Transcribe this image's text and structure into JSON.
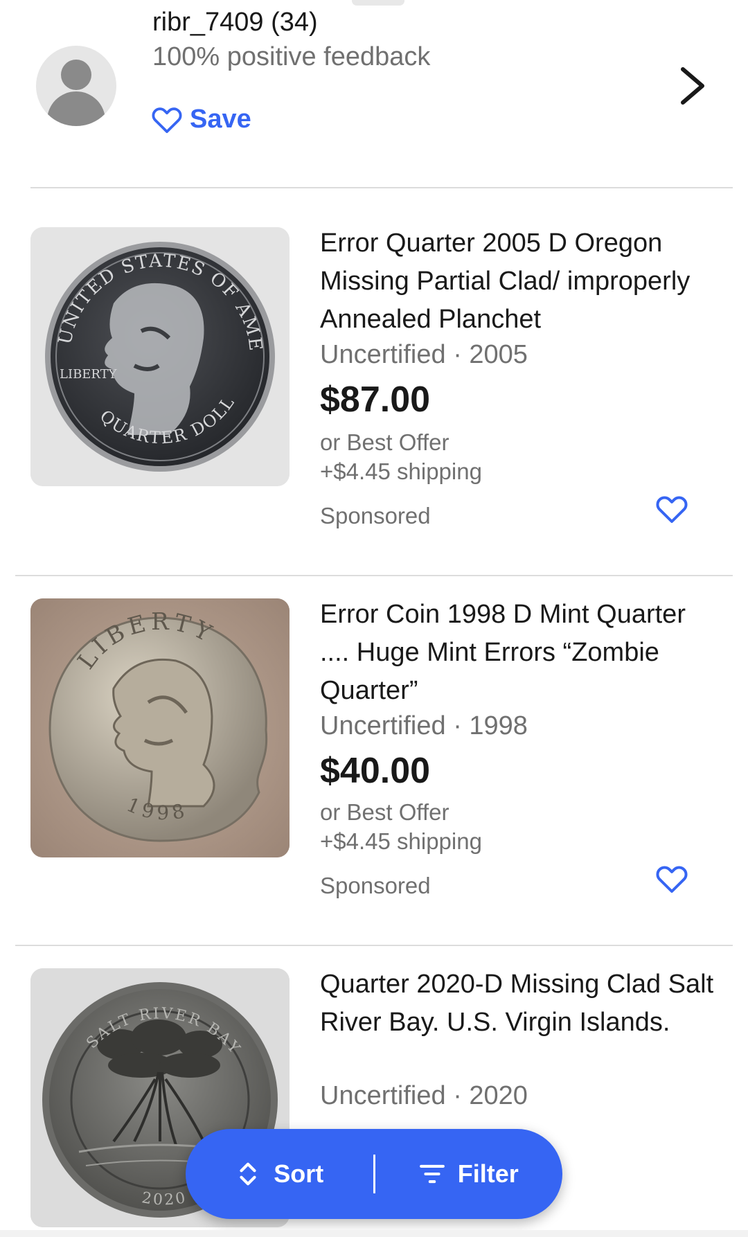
{
  "seller": {
    "name": "ribr_7409 (34)",
    "feedback": "100% positive feedback",
    "save_label": "Save"
  },
  "listings": [
    {
      "title": "Error Quarter 2005 D Oregon Missing Partial Clad/ improperly Annealed Planchet",
      "condition_year": "Uncertified · 2005",
      "price": "$87.00",
      "offer": "or Best Offer",
      "shipping": "+$4.45 shipping",
      "sponsored": "Sponsored",
      "coin_legend": "UNITED STATES OF AMERICA",
      "coin_bottom": "QUARTER DOLLAR",
      "coin_left": "LIBERTY"
    },
    {
      "title": "Error Coin 1998 D Mint Quarter .... Huge Mint Errors “Zombie Quarter”",
      "condition_year": "Uncertified · 1998",
      "price": "$40.00",
      "offer": "or Best Offer",
      "shipping": "+$4.45 shipping",
      "sponsored": "Sponsored",
      "coin_legend": "LIBERTY",
      "coin_bottom": "1998"
    },
    {
      "title": "Quarter 2020-D Missing Clad Salt River Bay. U.S. Virgin Islands.",
      "condition_year": "Uncertified · 2020",
      "coin_legend": "SALT RIVER BAY",
      "coin_bottom": "2020"
    }
  ],
  "fab": {
    "sort_label": "Sort",
    "filter_label": "Filter"
  },
  "colors": {
    "accent": "#3665f3",
    "text_primary": "#191919",
    "text_secondary": "#707070",
    "divider": "#dcdcdc"
  },
  "icons": [
    "heart-outline-icon",
    "chevron-right-icon",
    "sort-icon",
    "filter-icon",
    "avatar-placeholder-icon"
  ]
}
